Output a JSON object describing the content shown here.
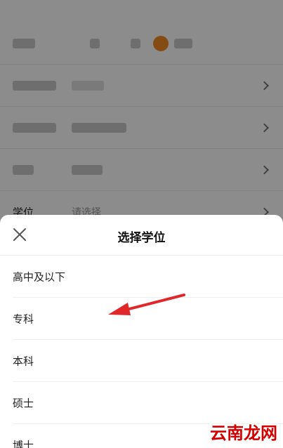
{
  "form": {
    "rows": [
      {
        "label": "",
        "value": ""
      },
      {
        "label": "",
        "value": ""
      },
      {
        "label": "",
        "value": ""
      },
      {
        "label": "",
        "value": ""
      },
      {
        "label": "学位",
        "value": "请选择"
      }
    ]
  },
  "sheet": {
    "title": "选择学位",
    "options": [
      "高中及以下",
      "专科",
      "本科",
      "硕士",
      "博士"
    ]
  },
  "watermark": {
    "text": "云南龙网"
  },
  "colors": {
    "accent": "#f08a24",
    "arrow": "#e0282a",
    "watermark": "#d40000"
  }
}
